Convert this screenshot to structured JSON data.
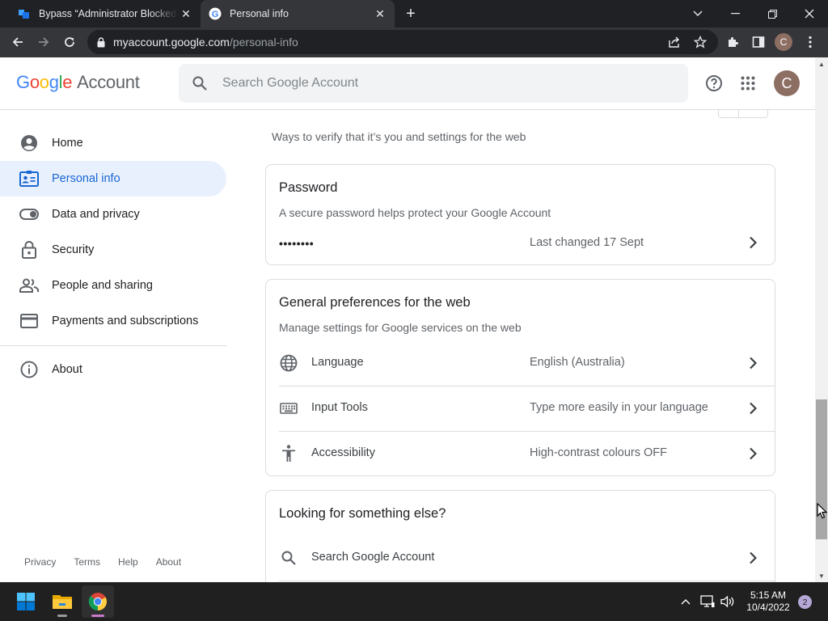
{
  "browser": {
    "tabs": [
      {
        "title": "Bypass “Administrator Blocked Yo",
        "active": false
      },
      {
        "title": "Personal info",
        "active": true
      }
    ],
    "url_host": "myaccount.google.com",
    "url_path": "/personal-info",
    "profile_initial": "C"
  },
  "header": {
    "logo_letters": [
      "G",
      "o",
      "o",
      "g",
      "l",
      "e"
    ],
    "logo_suffix": "Account",
    "search_placeholder": "Search Google Account",
    "avatar_initial": "C"
  },
  "sidebar": {
    "items": [
      {
        "label": "Home",
        "icon": "home-icon",
        "active": false
      },
      {
        "label": "Personal info",
        "icon": "personal-info-icon",
        "active": true
      },
      {
        "label": "Data and privacy",
        "icon": "toggle-icon",
        "active": false
      },
      {
        "label": "Security",
        "icon": "lock-icon",
        "active": false
      },
      {
        "label": "People and sharing",
        "icon": "people-icon",
        "active": false
      },
      {
        "label": "Payments and subscriptions",
        "icon": "credit-card-icon",
        "active": false
      },
      {
        "label": "About",
        "icon": "info-icon",
        "active": false
      }
    ],
    "footer": [
      "Privacy",
      "Terms",
      "Help",
      "About"
    ]
  },
  "main": {
    "section_subtitle": "Ways to verify that it’s you and settings for the web",
    "password_card": {
      "title": "Password",
      "subtitle": "A secure password helps protect your Google Account",
      "masked_value": "••••••••",
      "last_changed": "Last changed 17 Sept"
    },
    "prefs_card": {
      "title": "General preferences for the web",
      "subtitle": "Manage settings for Google services on the web",
      "rows": [
        {
          "label": "Language",
          "value": "English (Australia)",
          "icon": "globe-icon"
        },
        {
          "label": "Input Tools",
          "value": "Type more easily in your language",
          "icon": "keyboard-icon"
        },
        {
          "label": "Accessibility",
          "value": "High-contrast colours OFF",
          "icon": "accessibility-icon"
        }
      ]
    },
    "else_card": {
      "title": "Looking for something else?",
      "rows": [
        {
          "label": "Search Google Account",
          "icon": "search-icon"
        }
      ]
    }
  },
  "taskbar": {
    "time": "5:15 AM",
    "date": "10/4/2022",
    "notification_count": "2"
  },
  "colors": {
    "active_nav_bg": "#e8f0fe",
    "active_nav_text": "#1967d2",
    "browser_frame": "#202124",
    "toolbar": "#35363a",
    "taskbar": "#202020"
  }
}
